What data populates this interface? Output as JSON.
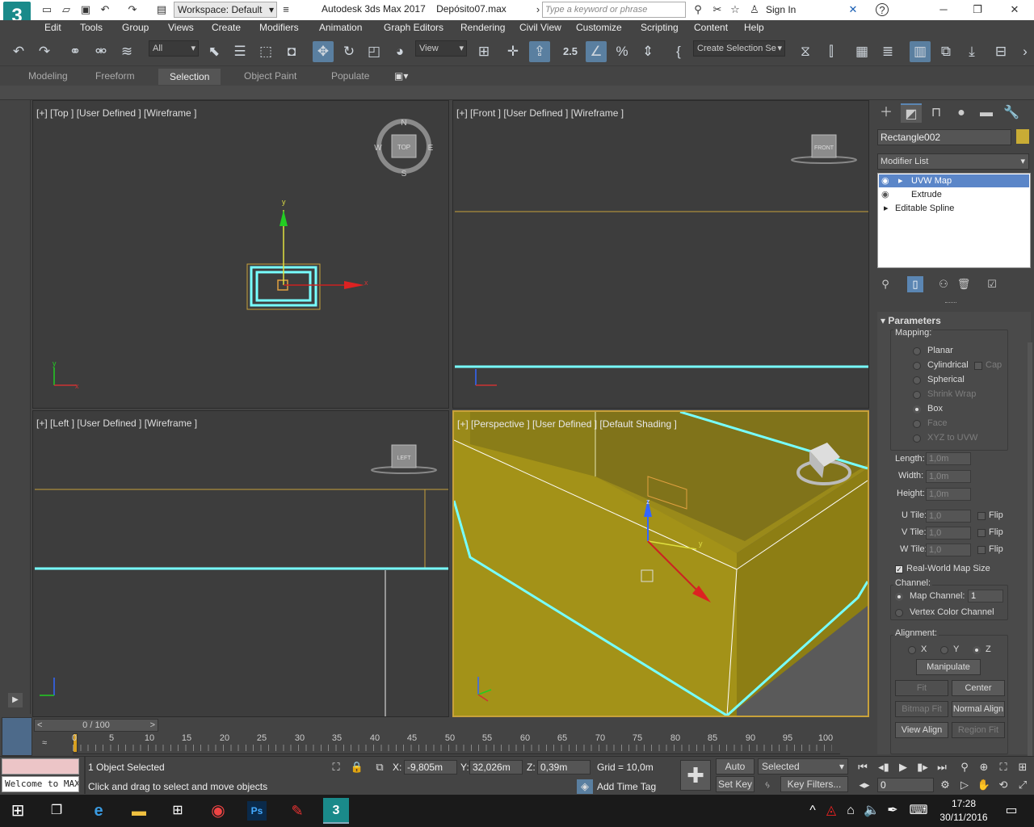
{
  "window": {
    "app_logo": "3",
    "workspace": "Workspace: Default",
    "title": "Autodesk 3ds Max 2017",
    "file": "Depósito07.max",
    "search_placeholder": "Type a keyword or phrase",
    "sign_in": "Sign In"
  },
  "menu": [
    "Edit",
    "Tools",
    "Group",
    "Views",
    "Create",
    "Modifiers",
    "Animation",
    "Graph Editors",
    "Rendering",
    "Civil View",
    "Customize",
    "Scripting",
    "Content",
    "Help"
  ],
  "toolbar": {
    "selection_filter": "All",
    "ref_coord": "View",
    "snap_angle": "2.5",
    "named_selection": "Create Selection Se"
  },
  "ribbon": {
    "tabs": [
      "Modeling",
      "Freeform",
      "Selection",
      "Object Paint",
      "Populate"
    ],
    "selected": "Selection"
  },
  "viewports": {
    "top": "[+] [Top ] [User Defined ] [Wireframe ]",
    "front": "[+] [Front ] [User Defined ] [Wireframe ]",
    "left": "[+] [Left ] [User Defined ] [Wireframe ]",
    "perspective": "[+] [Perspective ] [User Defined ] [Default Shading ]",
    "viewcube_top": "TOP",
    "viewcube_front": "FRONT",
    "viewcube_left": "LEFT",
    "compass": {
      "n": "N",
      "s": "S",
      "e": "E",
      "w": "W"
    },
    "axis_x": "x",
    "axis_y": "y",
    "axis_z": "z"
  },
  "command_panel": {
    "object_name": "Rectangle002",
    "object_color": "#c9ac35",
    "modifier_list": "Modifier List",
    "stack": [
      "UVW Map",
      "Extrude",
      "Editable Spline"
    ],
    "selected_stack": "UVW Map",
    "rollout_title": "Parameters",
    "mapping_label": "Mapping:",
    "mapping": [
      "Planar",
      "Cylindrical",
      "Spherical",
      "Shrink Wrap",
      "Box",
      "Face",
      "XYZ to UVW"
    ],
    "mapping_selected": "Box",
    "cap": "Cap",
    "length_label": "Length:",
    "length": "1,0m",
    "width_label": "Width:",
    "width": "1,0m",
    "height_label": "Height:",
    "height": "1,0m",
    "utile_label": "U Tile:",
    "utile": "1,0",
    "vtile_label": "V Tile:",
    "vtile": "1,0",
    "wtile_label": "W Tile:",
    "wtile": "1,0",
    "flip": "Flip",
    "real_world": "Real-World Map Size",
    "channel_label": "Channel:",
    "map_channel": "Map Channel:",
    "map_channel_value": "1",
    "vertex_color": "Vertex Color Channel",
    "alignment_label": "Alignment:",
    "align_x": "X",
    "align_y": "Y",
    "align_z": "Z",
    "manipulate": "Manipulate",
    "fit": "Fit",
    "center": "Center",
    "bitmap_fit": "Bitmap Fit",
    "normal_align": "Normal Align",
    "view_align": "View Align",
    "region_fit": "Region Fit"
  },
  "timeline": {
    "slider": "0 / 100",
    "ticks": [
      "0",
      "5",
      "10",
      "15",
      "20",
      "25",
      "30",
      "35",
      "40",
      "45",
      "50",
      "55",
      "60",
      "65",
      "70",
      "75",
      "80",
      "85",
      "90",
      "95",
      "100"
    ]
  },
  "status": {
    "maxscript": "Welcome to MAXScript.",
    "selected": "1 Object Selected",
    "prompt": "Click and drag to select and move objects",
    "x_label": "X:",
    "x": "-9,805m",
    "y_label": "Y:",
    "y": "32,026m",
    "z_label": "Z:",
    "z": "0,39m",
    "grid": "Grid = 10,0m",
    "add_time_tag": "Add Time Tag",
    "auto_key": "Auto Key",
    "set_key": "Set Key",
    "key_mode": "Selected",
    "key_filters": "Key Filters...",
    "frame": "0"
  },
  "taskbar": {
    "time": "17:28",
    "date": "30/11/2016",
    "ps": "Ps"
  }
}
